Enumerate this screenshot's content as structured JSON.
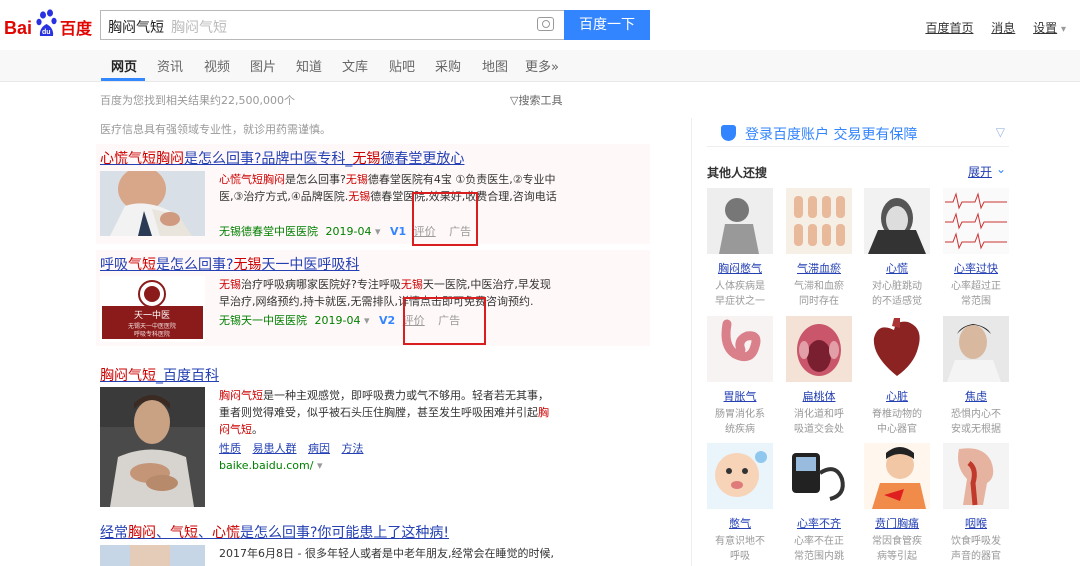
{
  "header": {
    "logo_text": "Bai百度",
    "query": "胸闷气短",
    "placeholder_ghost": "胸闷气短",
    "search_button": "百度一下",
    "links": [
      "百度首页",
      "消息",
      "设置"
    ]
  },
  "tabs": [
    "网页",
    "资讯",
    "视频",
    "图片",
    "知道",
    "文库",
    "贴吧",
    "采购",
    "地图",
    "更多»"
  ],
  "stats": "百度为您找到相关结果约22,500,000个",
  "tools": "搜索工具",
  "notice": "医疗信息具有强领域专业性，就诊用药需谨慎。",
  "results": [
    {
      "title_parts": [
        {
          "t": "心慌气短胸闷",
          "em": true
        },
        {
          "t": "是怎么回事?品牌中医专科_",
          "em": false
        },
        {
          "t": "无锡",
          "em": true
        },
        {
          "t": "德春堂更放心",
          "em": false
        }
      ],
      "abstract_parts": [
        {
          "t": "心慌气短胸闷",
          "em": true
        },
        {
          "t": "是怎么回事?",
          "em": false
        },
        {
          "t": "无锡",
          "em": true
        },
        {
          "t": "德春堂医院有4宝 ①负责医生,②专业中医,③治疗方式,④品牌医院.",
          "em": false
        },
        {
          "t": "无锡",
          "em": true
        },
        {
          "t": "德春堂医院,效果好,收费合理,咨询电话",
          "em": false
        }
      ],
      "source": "无锡德春堂中医医院",
      "date": "2019-04",
      "v_level": "V1",
      "review": "评价",
      "ad": "广告"
    },
    {
      "title_parts": [
        {
          "t": "呼吸",
          "em": false
        },
        {
          "t": "气短",
          "em": true
        },
        {
          "t": "是怎么回事?",
          "em": false
        },
        {
          "t": "无锡",
          "em": true
        },
        {
          "t": "天一中医呼吸科",
          "em": false
        }
      ],
      "abstract_parts": [
        {
          "t": "无锡",
          "em": true
        },
        {
          "t": "治疗呼吸病哪家医院好?专注呼吸",
          "em": false
        },
        {
          "t": "无锡",
          "em": true
        },
        {
          "t": "天一医院,中医治疗,早发现早治疗,网络预约,持卡就医,无需排队,详情点击即可免费咨询预约.",
          "em": false
        }
      ],
      "source": "无锡天一中医医院",
      "date": "2019-04",
      "v_level": "V2",
      "review": "评价",
      "ad": "广告",
      "thumb_text": [
        "天一中医",
        "无锡天一中医医院",
        "呼吸专科医院"
      ]
    },
    {
      "title_parts": [
        {
          "t": "胸闷气短",
          "em": true
        },
        {
          "t": "_百度百科",
          "em": false
        }
      ],
      "abstract_parts": [
        {
          "t": "胸闷气短",
          "em": true
        },
        {
          "t": "是一种主观感觉，即呼吸费力或气不够用。轻者若无其事，重者则觉得难受，似乎被石头压住胸膛，甚至发生呼吸困难并引起",
          "em": false
        },
        {
          "t": "胸闷气短",
          "em": true
        },
        {
          "t": "。",
          "em": false
        }
      ],
      "links": [
        "性质",
        "易患人群",
        "病因",
        "方法"
      ],
      "url": "baike.baidu.com/"
    },
    {
      "title_parts": [
        {
          "t": "经常",
          "em": false
        },
        {
          "t": "胸闷",
          "em": true
        },
        {
          "t": "、",
          "em": false
        },
        {
          "t": "气短",
          "em": true
        },
        {
          "t": "、",
          "em": false
        },
        {
          "t": "心慌",
          "em": true
        },
        {
          "t": "是怎么回事?你可能患上了这种病!",
          "em": false
        }
      ],
      "abstract_parts": [
        {
          "t": "2017年6月8日 - 很多年轻人或者是中老年朋友,经常会在睡觉的时候,",
          "em": false
        }
      ]
    }
  ],
  "right": {
    "login_text": "登录百度账户  交易更有保障",
    "related_title": "其他人还搜",
    "expand": "展开",
    "cards": [
      {
        "name": "胸闷憋气",
        "desc": [
          "人体疾病是",
          "早症状之一"
        ]
      },
      {
        "name": "气滞血瘀",
        "desc": [
          "气滞和血瘀",
          "同时存在"
        ]
      },
      {
        "name": "心慌",
        "desc": [
          "对心脏跳动",
          "的不适感觉"
        ]
      },
      {
        "name": "心率过快",
        "desc": [
          "心率超过正",
          "常范围"
        ]
      },
      {
        "name": "胃胀气",
        "desc": [
          "肠胃消化系",
          "统疾病"
        ]
      },
      {
        "name": "扁桃体",
        "desc": [
          "消化道和呼",
          "吸道交会处"
        ]
      },
      {
        "name": "心脏",
        "desc": [
          "脊椎动物的",
          "中心器官"
        ]
      },
      {
        "name": "焦虑",
        "desc": [
          "恐惧内心不",
          "安或无根据"
        ]
      },
      {
        "name": "憋气",
        "desc": [
          "有意识地不",
          "呼吸"
        ]
      },
      {
        "name": "心率不齐",
        "desc": [
          "心率不在正",
          "常范围内跳"
        ]
      },
      {
        "name": "贲门胸痛",
        "desc": [
          "常因食管疾",
          "病等引起"
        ]
      },
      {
        "name": "咽喉",
        "desc": [
          "饮食呼吸发",
          "声音的器官"
        ]
      }
    ]
  }
}
